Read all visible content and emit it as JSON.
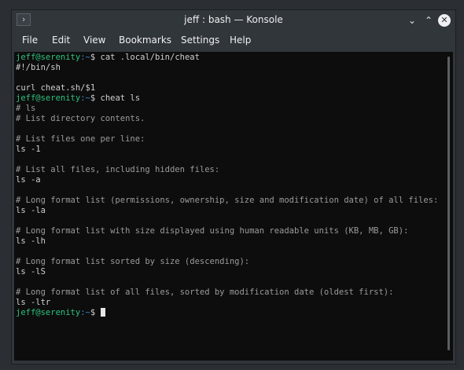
{
  "window": {
    "title": "jeff : bash — Konsole",
    "app_icon_glyph": "›",
    "controls": {
      "minimize_glyph": "⌄",
      "maximize_glyph": "⌃",
      "close_glyph": "✕"
    }
  },
  "menu": [
    "File",
    "Edit",
    "View",
    "Bookmarks",
    "Settings",
    "Help"
  ],
  "prompt": {
    "user": "jeff@serenity",
    "path": ":~",
    "symbol": "$ "
  },
  "terminal_lines": [
    {
      "type": "prompt",
      "cmd": "cat .local/bin/cheat"
    },
    {
      "type": "plain",
      "text": "#!/bin/sh"
    },
    {
      "type": "plain",
      "text": ""
    },
    {
      "type": "plain",
      "text": "curl cheat.sh/$1"
    },
    {
      "type": "prompt",
      "cmd": "cheat ls"
    },
    {
      "type": "comment",
      "text": "# ls"
    },
    {
      "type": "comment",
      "text": "# List directory contents."
    },
    {
      "type": "plain",
      "text": ""
    },
    {
      "type": "comment",
      "text": "# List files one per line:"
    },
    {
      "type": "plain",
      "text": "ls -1"
    },
    {
      "type": "plain",
      "text": ""
    },
    {
      "type": "comment",
      "text": "# List all files, including hidden files:"
    },
    {
      "type": "plain",
      "text": "ls -a"
    },
    {
      "type": "plain",
      "text": ""
    },
    {
      "type": "comment",
      "text": "# Long format list (permissions, ownership, size and modification date) of all files:"
    },
    {
      "type": "plain",
      "text": "ls -la"
    },
    {
      "type": "plain",
      "text": ""
    },
    {
      "type": "comment",
      "text": "# Long format list with size displayed using human readable units (KB, MB, GB):"
    },
    {
      "type": "plain",
      "text": "ls -lh"
    },
    {
      "type": "plain",
      "text": ""
    },
    {
      "type": "comment",
      "text": "# Long format list sorted by size (descending):"
    },
    {
      "type": "plain",
      "text": "ls -lS"
    },
    {
      "type": "plain",
      "text": ""
    },
    {
      "type": "comment",
      "text": "# Long format list of all files, sorted by modification date (oldest first):"
    },
    {
      "type": "plain",
      "text": "ls -ltr"
    },
    {
      "type": "prompt_cursor",
      "cmd": ""
    }
  ]
}
